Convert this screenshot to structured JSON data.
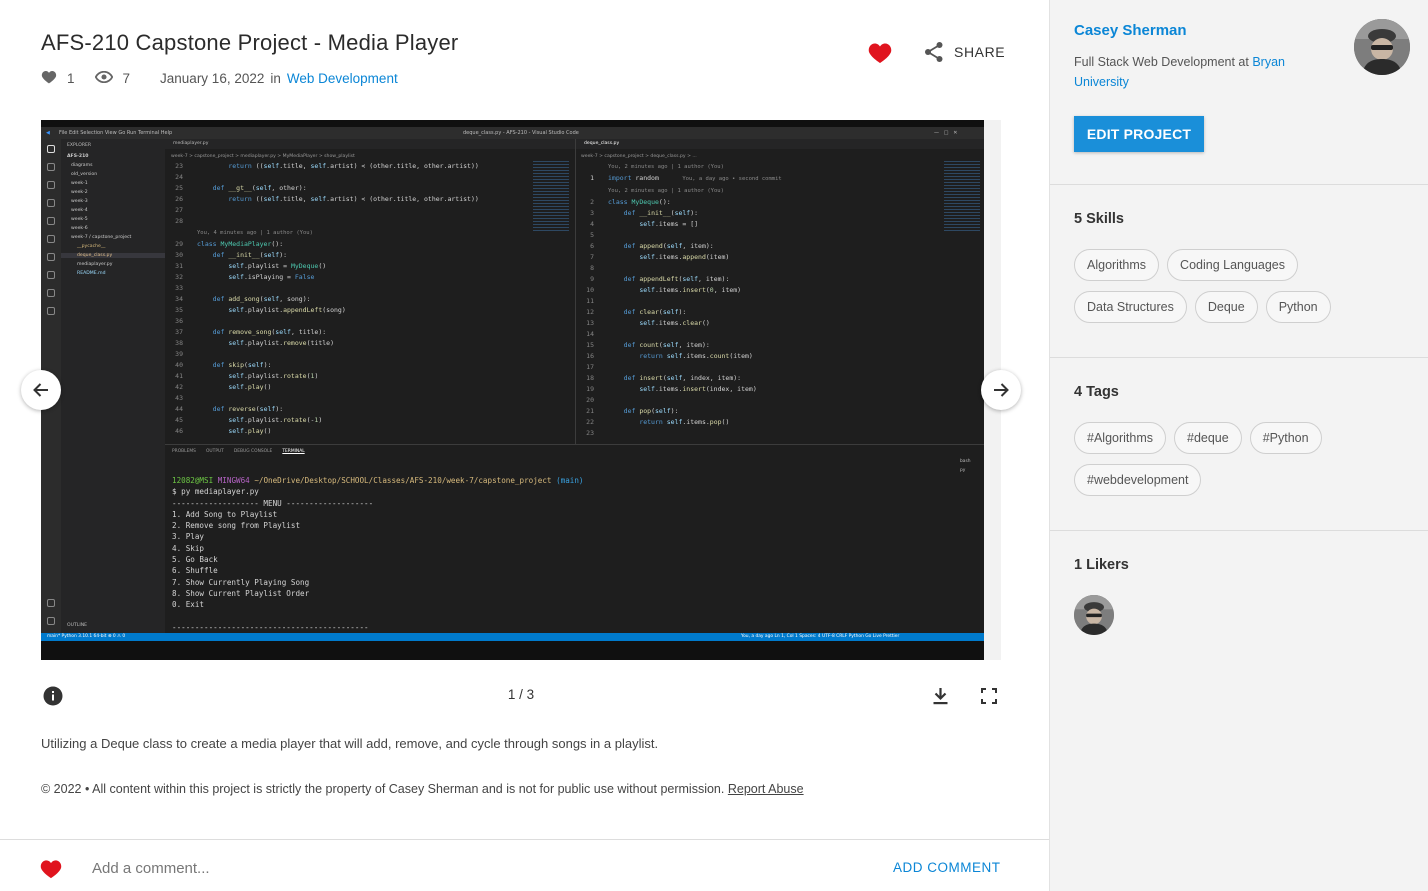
{
  "project": {
    "title": "AFS-210 Capstone Project - Media Player",
    "likes": "1",
    "views": "7",
    "date": "January 16, 2022",
    "in_label": "in",
    "category": "Web Development",
    "share_label": "SHARE"
  },
  "viewer": {
    "pager": "1 / 3",
    "icons": {
      "prev": "arrow-left-icon",
      "next": "arrow-right-icon",
      "info": "info-icon",
      "download": "download-icon",
      "fullscreen": "fullscreen-icon"
    },
    "screenshot": {
      "window_title": "deque_class.py - AFS-210 - Visual Studio Code",
      "menu": [
        "File",
        "Edit",
        "Selection",
        "View",
        "Go",
        "Run",
        "Terminal",
        "Help"
      ],
      "explorer": {
        "header": "EXPLORER",
        "root": "AFS-210",
        "items": [
          "diagrams",
          "old_version",
          "week-1",
          "week-2",
          "week-3",
          "week-4",
          "week-5",
          "week-6",
          "week-7 / capstone_project",
          "__pycache__",
          "deque_class.py",
          "mediaplayer.py",
          "README.md"
        ],
        "outline": "OUTLINE"
      },
      "left_tab": "mediaplayer.py",
      "right_tab": "deque_class.py",
      "left_crumb": "week-7 > capstone_project > mediaplayer.py > MyMediaPlayer > show_playlist",
      "right_crumb": "week-7 > capstone_project > deque_class.py > ...",
      "blame_left": "You, 4 minutes ago | 1 author (You)",
      "blame_right_1": "You, 2 minutes ago | 1 author (You)",
      "blame_right_2": "You, 2 minutes ago | 1 author (You)",
      "ghost": "You, a day ago • second commit",
      "panel_tabs": [
        "PROBLEMS",
        "OUTPUT",
        "DEBUG CONSOLE",
        "TERMINAL"
      ],
      "term_side": [
        "bash",
        "py"
      ],
      "terminal": {
        "user": "12082@MSI",
        "shell": "MINGW64",
        "path": "~/OneDrive/Desktop/SCHOOL/Classes/AFS-210/week-7/capstone_project",
        "branch": "(main)",
        "command": "$ py mediaplayer.py",
        "menu_header": "------------------- MENU -------------------",
        "options": [
          "1. Add Song to Playlist",
          "2. Remove song from Playlist",
          "3. Play",
          "4. Skip",
          "5. Go Back",
          "6. Shuffle",
          "7. Show Currently Playing Song",
          "8. Show Current Playlist Order",
          "0. Exit"
        ],
        "menu_footer": "-------------------------------------------"
      },
      "status_left": "main*   Python 3.10.1 64-bit   ⊗ 0 ⚠ 0",
      "status_right": "You, a day ago   Ln 1, Col 1   Spaces: 4   UTF-8   CRLF   Python   Go Live   Prettier"
    }
  },
  "description": "Utilizing a Deque class to create a media player that will add, remove, and cycle through songs in a playlist.",
  "copyright": {
    "text": "© 2022 • All content within this project is strictly the property of Casey Sherman and is not for public use without permission.",
    "report_link": "Report Abuse"
  },
  "comment": {
    "placeholder": "Add a comment...",
    "submit_label": "ADD COMMENT"
  },
  "sidebar": {
    "owner_name": "Casey Sherman",
    "owner_role": "Full Stack Web Development at",
    "owner_school": "Bryan University",
    "edit_label": "EDIT PROJECT",
    "skills_title": "5 Skills",
    "skills": [
      "Algorithms",
      "Coding Languages",
      "Data Structures",
      "Deque",
      "Python"
    ],
    "tags_title": "4 Tags",
    "tags": [
      "#Algorithms",
      "#deque",
      "#Python",
      "#webdevelopment"
    ],
    "likers_title": "1 Likers"
  },
  "colors": {
    "accent": "#0b86d6",
    "button": "#1a8fd9",
    "heart": "#e0141e",
    "sidebar_bg": "#f3f3f3",
    "editor_bg": "#1e1e1e",
    "statusbar": "#007acc"
  }
}
